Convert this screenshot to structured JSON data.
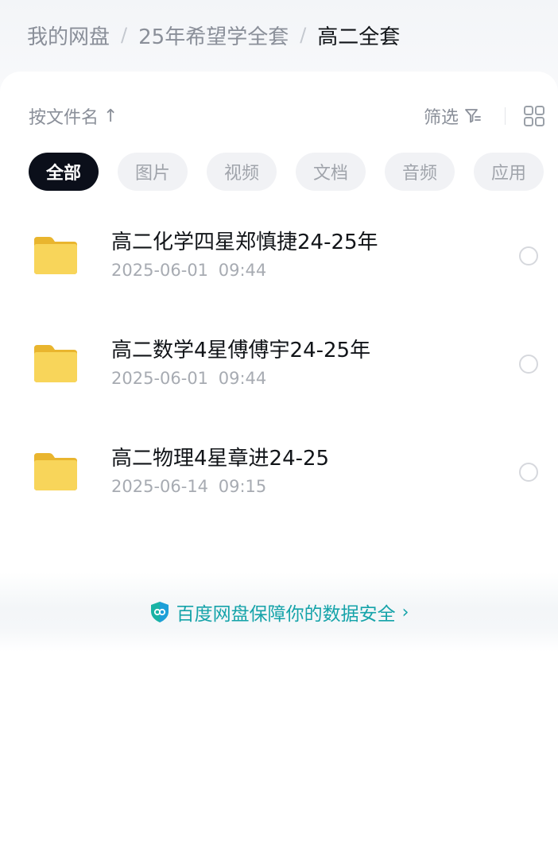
{
  "breadcrumb": {
    "items": [
      "我的网盘",
      "25年希望学全套",
      "高二全套"
    ],
    "separator": "/"
  },
  "toolbar": {
    "sort_label": "按文件名",
    "sort_arrow": "↑",
    "filter_label": "筛选",
    "view_icon": "grid-view-icon"
  },
  "tabs": [
    {
      "label": "全部",
      "active": true
    },
    {
      "label": "图片",
      "active": false
    },
    {
      "label": "视频",
      "active": false
    },
    {
      "label": "文档",
      "active": false
    },
    {
      "label": "音频",
      "active": false
    },
    {
      "label": "应用",
      "active": false
    }
  ],
  "files": [
    {
      "name": "高二化学四星郑慎捷24-25年",
      "date": "2025-06-01 09:44",
      "type": "folder"
    },
    {
      "name": "高二数学4星傅傅宇24-25年",
      "date": "2025-06-01 09:44",
      "type": "folder"
    },
    {
      "name": "高二物理4星章进24-25",
      "date": "2025-06-14 09:15",
      "type": "folder"
    }
  ],
  "security": {
    "text": "百度网盘保障你的数据安全",
    "chevron": "›"
  },
  "colors": {
    "accent": "#15a3a9",
    "active_tab_bg": "#0b0f1a",
    "folder": "#f5c842",
    "muted_text": "#8a8f99"
  }
}
